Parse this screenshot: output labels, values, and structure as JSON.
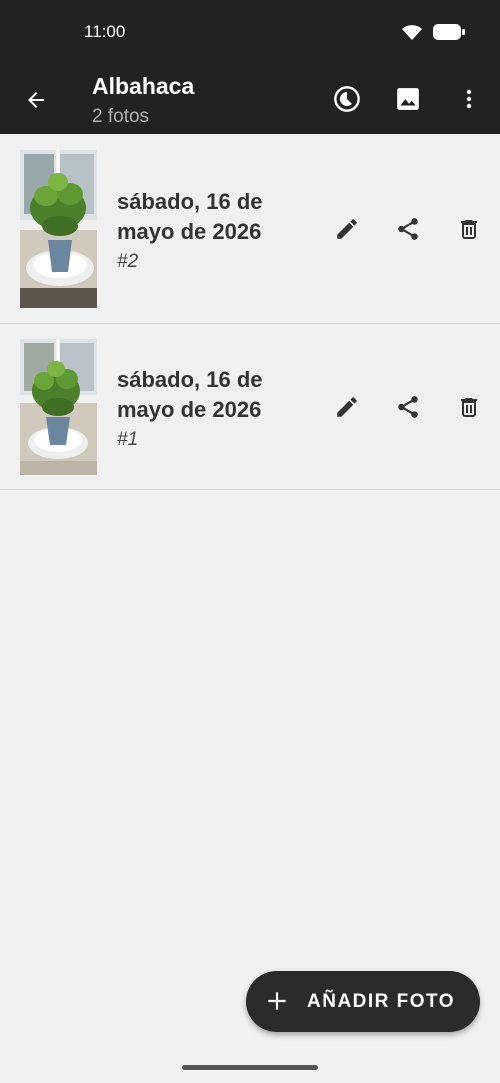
{
  "status": {
    "time": "11:00"
  },
  "header": {
    "title": "Albahaca",
    "subtitle": "2 fotos"
  },
  "entries": [
    {
      "date_line1": "sábado, 16 de",
      "date_line2": "mayo de 2026",
      "number": "#2"
    },
    {
      "date_line1": "sábado, 16 de",
      "date_line2": "mayo de 2026",
      "number": "#1"
    }
  ],
  "fab": {
    "label": "AÑADIR FOTO"
  },
  "colors": {
    "appbar": "#222222",
    "background": "#f0f0f0",
    "fab": "#2b2b2b",
    "text": "#333333"
  },
  "icons": [
    "back-arrow-icon",
    "timelapse-icon",
    "image-icon",
    "more-vert-icon",
    "edit-icon",
    "share-icon",
    "delete-icon",
    "plus-icon",
    "wifi-icon",
    "battery-icon"
  ]
}
